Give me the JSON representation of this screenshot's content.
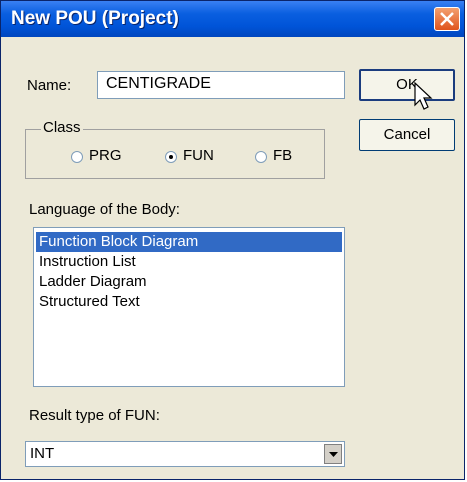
{
  "window": {
    "title": "New POU (Project)"
  },
  "name": {
    "label": "Name:",
    "value": "CENTIGRADE"
  },
  "buttons": {
    "ok": "OK",
    "cancel": "Cancel"
  },
  "class_group": {
    "legend": "Class",
    "options": [
      "PRG",
      "FUN",
      "FB"
    ],
    "selected": "FUN"
  },
  "language": {
    "label": "Language of the Body:",
    "items": [
      "Function Block Diagram",
      "Instruction List",
      "Ladder Diagram",
      "Structured Text"
    ],
    "selected": "Function Block Diagram"
  },
  "result_type": {
    "label": "Result type of FUN:",
    "value": "INT"
  },
  "colors": {
    "titlebar": "#0054d8",
    "selection": "#316ac5",
    "dialog_bg": "#ece9d8"
  }
}
